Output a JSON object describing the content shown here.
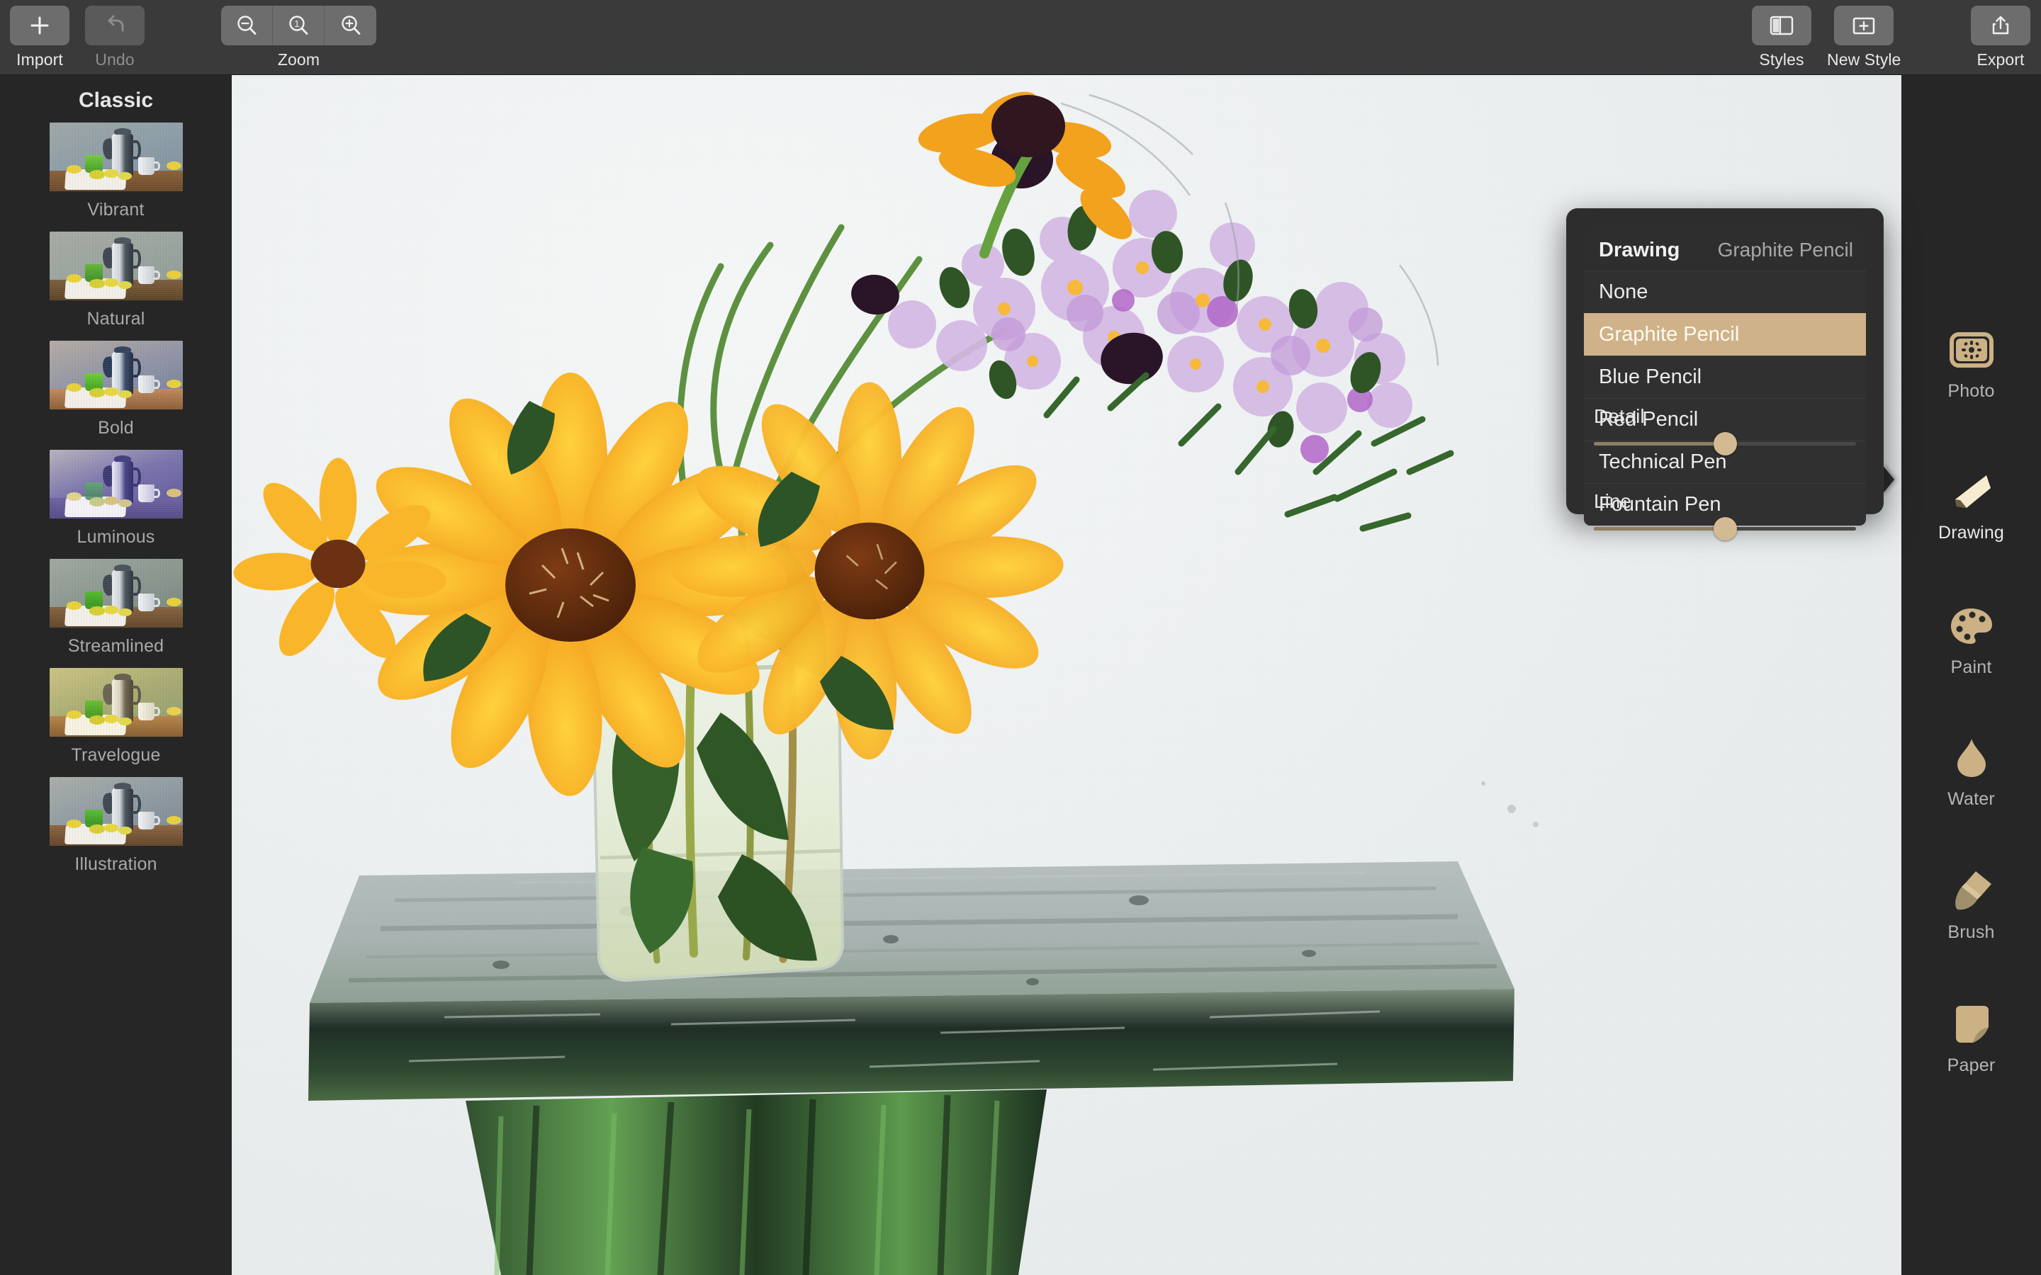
{
  "toolbar": {
    "import_label": "Import",
    "undo_label": "Undo",
    "zoom_label": "Zoom",
    "zoom_out_icon": "zoom-out-magnifier-icon",
    "zoom_actual_icon": "zoom-actual-size-magnifier-icon",
    "zoom_actual_value": "1",
    "zoom_in_icon": "zoom-in-magnifier-icon",
    "styles_label": "Styles",
    "new_style_label": "New Style",
    "export_label": "Export"
  },
  "left_panel": {
    "title": "Classic",
    "presets": [
      {
        "name": "Vibrant"
      },
      {
        "name": "Natural"
      },
      {
        "name": "Bold"
      },
      {
        "name": "Luminous"
      },
      {
        "name": "Streamlined"
      },
      {
        "name": "Travelogue"
      },
      {
        "name": "Illustration"
      }
    ]
  },
  "right_panel": {
    "items": [
      {
        "label": "Photo",
        "icon": "photo-brightness-icon",
        "active": false
      },
      {
        "label": "Drawing",
        "icon": "pencil-marker-icon",
        "active": true
      },
      {
        "label": "Paint",
        "icon": "palette-icon",
        "active": false
      },
      {
        "label": "Water",
        "icon": "water-drop-icon",
        "active": false
      },
      {
        "label": "Brush",
        "icon": "paintbrush-icon",
        "active": false
      },
      {
        "label": "Paper",
        "icon": "paper-curl-icon",
        "active": false
      }
    ]
  },
  "popup": {
    "header_title": "Drawing",
    "header_value": "Graphite Pencil",
    "options": [
      {
        "label": "None",
        "selected": false
      },
      {
        "label": "Graphite Pencil",
        "selected": true
      },
      {
        "label": "Blue Pencil",
        "selected": false
      },
      {
        "label": "Red Pencil",
        "selected": false
      },
      {
        "label": "Technical Pen",
        "selected": false
      },
      {
        "label": "Fountain Pen",
        "selected": false
      }
    ],
    "sliders": [
      {
        "label": "Detail",
        "percent": 50
      },
      {
        "label": "Line",
        "percent": 50
      }
    ]
  },
  "colors": {
    "accent": "#cfb289",
    "panel_bg": "#262626",
    "toolbar_bg": "#3a3a3a",
    "popup_bg": "#2d2d2d",
    "canvas_paper": "#eceff0"
  }
}
